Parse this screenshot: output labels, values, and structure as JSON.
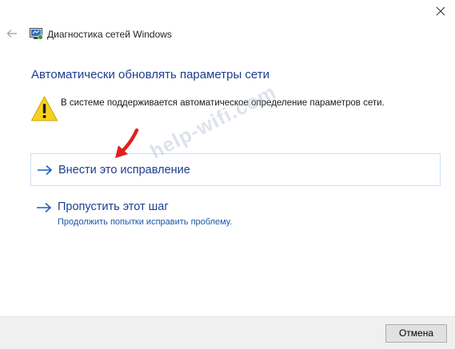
{
  "window": {
    "title": "Диагностика сетей Windows"
  },
  "icons": {
    "back": "back-arrow-icon",
    "close": "close-icon",
    "app": "network-diagnostics-icon",
    "warning": "warning-icon"
  },
  "main": {
    "heading": "Автоматически обновлять параметры сети",
    "warning_text": "В системе поддерживается автоматическое определение параметров сети."
  },
  "options": {
    "apply": {
      "label": "Внести это исправление"
    },
    "skip": {
      "label": "Пропустить этот шаг",
      "sublabel": "Продолжить попытки исправить проблему."
    }
  },
  "watermark": "help-wifi.com",
  "footer": {
    "cancel_label": "Отмена"
  },
  "colors": {
    "heading": "#1e3d8f",
    "link": "#1a56a8",
    "option_border": "#cfe0f3",
    "footer_bg": "#f0f0f0",
    "annotation_arrow": "#e0201b"
  }
}
